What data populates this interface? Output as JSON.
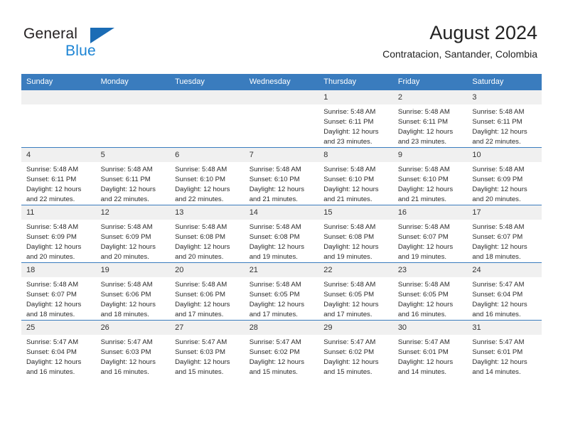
{
  "brand": {
    "name_part1": "General",
    "name_part2": "Blue",
    "triangle_color": "#1b6cb5",
    "blue_color": "#1c84d4"
  },
  "header": {
    "title": "August 2024",
    "subtitle": "Contratacion, Santander, Colombia",
    "accent_color": "#3a7cbe"
  },
  "weekdays": [
    "Sunday",
    "Monday",
    "Tuesday",
    "Wednesday",
    "Thursday",
    "Friday",
    "Saturday"
  ],
  "weeks": [
    [
      {
        "day": "",
        "sunrise": "",
        "sunset": "",
        "daylight1": "",
        "daylight2": ""
      },
      {
        "day": "",
        "sunrise": "",
        "sunset": "",
        "daylight1": "",
        "daylight2": ""
      },
      {
        "day": "",
        "sunrise": "",
        "sunset": "",
        "daylight1": "",
        "daylight2": ""
      },
      {
        "day": "",
        "sunrise": "",
        "sunset": "",
        "daylight1": "",
        "daylight2": ""
      },
      {
        "day": "1",
        "sunrise": "Sunrise: 5:48 AM",
        "sunset": "Sunset: 6:11 PM",
        "daylight1": "Daylight: 12 hours",
        "daylight2": "and 23 minutes."
      },
      {
        "day": "2",
        "sunrise": "Sunrise: 5:48 AM",
        "sunset": "Sunset: 6:11 PM",
        "daylight1": "Daylight: 12 hours",
        "daylight2": "and 23 minutes."
      },
      {
        "day": "3",
        "sunrise": "Sunrise: 5:48 AM",
        "sunset": "Sunset: 6:11 PM",
        "daylight1": "Daylight: 12 hours",
        "daylight2": "and 22 minutes."
      }
    ],
    [
      {
        "day": "4",
        "sunrise": "Sunrise: 5:48 AM",
        "sunset": "Sunset: 6:11 PM",
        "daylight1": "Daylight: 12 hours",
        "daylight2": "and 22 minutes."
      },
      {
        "day": "5",
        "sunrise": "Sunrise: 5:48 AM",
        "sunset": "Sunset: 6:11 PM",
        "daylight1": "Daylight: 12 hours",
        "daylight2": "and 22 minutes."
      },
      {
        "day": "6",
        "sunrise": "Sunrise: 5:48 AM",
        "sunset": "Sunset: 6:10 PM",
        "daylight1": "Daylight: 12 hours",
        "daylight2": "and 22 minutes."
      },
      {
        "day": "7",
        "sunrise": "Sunrise: 5:48 AM",
        "sunset": "Sunset: 6:10 PM",
        "daylight1": "Daylight: 12 hours",
        "daylight2": "and 21 minutes."
      },
      {
        "day": "8",
        "sunrise": "Sunrise: 5:48 AM",
        "sunset": "Sunset: 6:10 PM",
        "daylight1": "Daylight: 12 hours",
        "daylight2": "and 21 minutes."
      },
      {
        "day": "9",
        "sunrise": "Sunrise: 5:48 AM",
        "sunset": "Sunset: 6:10 PM",
        "daylight1": "Daylight: 12 hours",
        "daylight2": "and 21 minutes."
      },
      {
        "day": "10",
        "sunrise": "Sunrise: 5:48 AM",
        "sunset": "Sunset: 6:09 PM",
        "daylight1": "Daylight: 12 hours",
        "daylight2": "and 20 minutes."
      }
    ],
    [
      {
        "day": "11",
        "sunrise": "Sunrise: 5:48 AM",
        "sunset": "Sunset: 6:09 PM",
        "daylight1": "Daylight: 12 hours",
        "daylight2": "and 20 minutes."
      },
      {
        "day": "12",
        "sunrise": "Sunrise: 5:48 AM",
        "sunset": "Sunset: 6:09 PM",
        "daylight1": "Daylight: 12 hours",
        "daylight2": "and 20 minutes."
      },
      {
        "day": "13",
        "sunrise": "Sunrise: 5:48 AM",
        "sunset": "Sunset: 6:08 PM",
        "daylight1": "Daylight: 12 hours",
        "daylight2": "and 20 minutes."
      },
      {
        "day": "14",
        "sunrise": "Sunrise: 5:48 AM",
        "sunset": "Sunset: 6:08 PM",
        "daylight1": "Daylight: 12 hours",
        "daylight2": "and 19 minutes."
      },
      {
        "day": "15",
        "sunrise": "Sunrise: 5:48 AM",
        "sunset": "Sunset: 6:08 PM",
        "daylight1": "Daylight: 12 hours",
        "daylight2": "and 19 minutes."
      },
      {
        "day": "16",
        "sunrise": "Sunrise: 5:48 AM",
        "sunset": "Sunset: 6:07 PM",
        "daylight1": "Daylight: 12 hours",
        "daylight2": "and 19 minutes."
      },
      {
        "day": "17",
        "sunrise": "Sunrise: 5:48 AM",
        "sunset": "Sunset: 6:07 PM",
        "daylight1": "Daylight: 12 hours",
        "daylight2": "and 18 minutes."
      }
    ],
    [
      {
        "day": "18",
        "sunrise": "Sunrise: 5:48 AM",
        "sunset": "Sunset: 6:07 PM",
        "daylight1": "Daylight: 12 hours",
        "daylight2": "and 18 minutes."
      },
      {
        "day": "19",
        "sunrise": "Sunrise: 5:48 AM",
        "sunset": "Sunset: 6:06 PM",
        "daylight1": "Daylight: 12 hours",
        "daylight2": "and 18 minutes."
      },
      {
        "day": "20",
        "sunrise": "Sunrise: 5:48 AM",
        "sunset": "Sunset: 6:06 PM",
        "daylight1": "Daylight: 12 hours",
        "daylight2": "and 17 minutes."
      },
      {
        "day": "21",
        "sunrise": "Sunrise: 5:48 AM",
        "sunset": "Sunset: 6:05 PM",
        "daylight1": "Daylight: 12 hours",
        "daylight2": "and 17 minutes."
      },
      {
        "day": "22",
        "sunrise": "Sunrise: 5:48 AM",
        "sunset": "Sunset: 6:05 PM",
        "daylight1": "Daylight: 12 hours",
        "daylight2": "and 17 minutes."
      },
      {
        "day": "23",
        "sunrise": "Sunrise: 5:48 AM",
        "sunset": "Sunset: 6:05 PM",
        "daylight1": "Daylight: 12 hours",
        "daylight2": "and 16 minutes."
      },
      {
        "day": "24",
        "sunrise": "Sunrise: 5:47 AM",
        "sunset": "Sunset: 6:04 PM",
        "daylight1": "Daylight: 12 hours",
        "daylight2": "and 16 minutes."
      }
    ],
    [
      {
        "day": "25",
        "sunrise": "Sunrise: 5:47 AM",
        "sunset": "Sunset: 6:04 PM",
        "daylight1": "Daylight: 12 hours",
        "daylight2": "and 16 minutes."
      },
      {
        "day": "26",
        "sunrise": "Sunrise: 5:47 AM",
        "sunset": "Sunset: 6:03 PM",
        "daylight1": "Daylight: 12 hours",
        "daylight2": "and 16 minutes."
      },
      {
        "day": "27",
        "sunrise": "Sunrise: 5:47 AM",
        "sunset": "Sunset: 6:03 PM",
        "daylight1": "Daylight: 12 hours",
        "daylight2": "and 15 minutes."
      },
      {
        "day": "28",
        "sunrise": "Sunrise: 5:47 AM",
        "sunset": "Sunset: 6:02 PM",
        "daylight1": "Daylight: 12 hours",
        "daylight2": "and 15 minutes."
      },
      {
        "day": "29",
        "sunrise": "Sunrise: 5:47 AM",
        "sunset": "Sunset: 6:02 PM",
        "daylight1": "Daylight: 12 hours",
        "daylight2": "and 15 minutes."
      },
      {
        "day": "30",
        "sunrise": "Sunrise: 5:47 AM",
        "sunset": "Sunset: 6:01 PM",
        "daylight1": "Daylight: 12 hours",
        "daylight2": "and 14 minutes."
      },
      {
        "day": "31",
        "sunrise": "Sunrise: 5:47 AM",
        "sunset": "Sunset: 6:01 PM",
        "daylight1": "Daylight: 12 hours",
        "daylight2": "and 14 minutes."
      }
    ]
  ]
}
